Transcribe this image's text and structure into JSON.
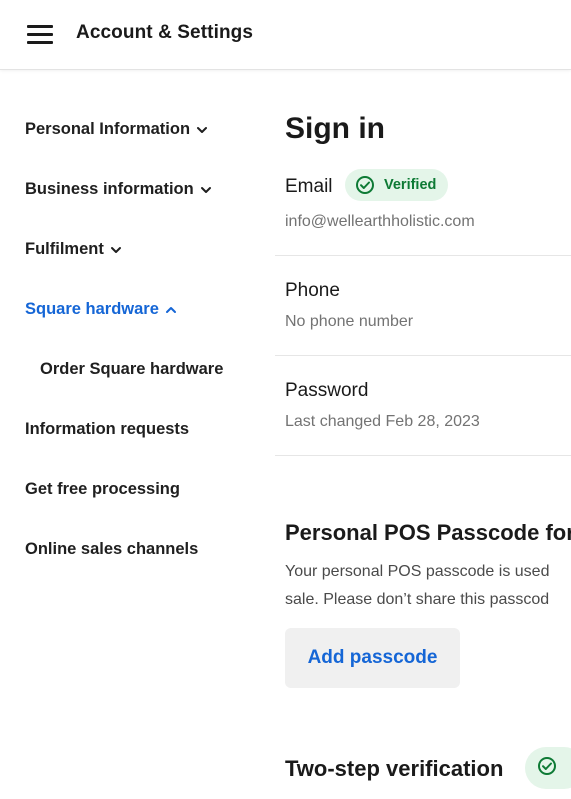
{
  "header": {
    "title": "Account & Settings",
    "menu_icon": "hamburger-menu-icon"
  },
  "sidebar": {
    "items": [
      {
        "label": "Personal Information",
        "chevron": "down"
      },
      {
        "label": "Business information",
        "chevron": "down"
      },
      {
        "label": "Fulfilment",
        "chevron": "down"
      },
      {
        "label": "Square hardware",
        "chevron": "up",
        "active": true
      },
      {
        "label": "Order Square hardware",
        "sub": true
      },
      {
        "label": "Information requests"
      },
      {
        "label": "Get free processing"
      },
      {
        "label": "Online sales channels"
      }
    ]
  },
  "main": {
    "title": "Sign in",
    "email": {
      "label": "Email",
      "value": "info@wellearthholistic.com",
      "badge": "Verified"
    },
    "phone": {
      "label": "Phone",
      "value": "No phone number"
    },
    "password": {
      "label": "Password",
      "value": "Last changed Feb 28, 2023"
    },
    "pos_passcode": {
      "title": "Personal POS Passcode for",
      "line1": "Your personal POS passcode is used",
      "line2": "sale. Please don’t share this passcod",
      "button": "Add passcode"
    },
    "two_step": {
      "title": "Two-step verification"
    }
  },
  "colors": {
    "accent": "#1566d6",
    "verified_bg": "#e4f5e9",
    "verified_text": "#0e7a35"
  }
}
